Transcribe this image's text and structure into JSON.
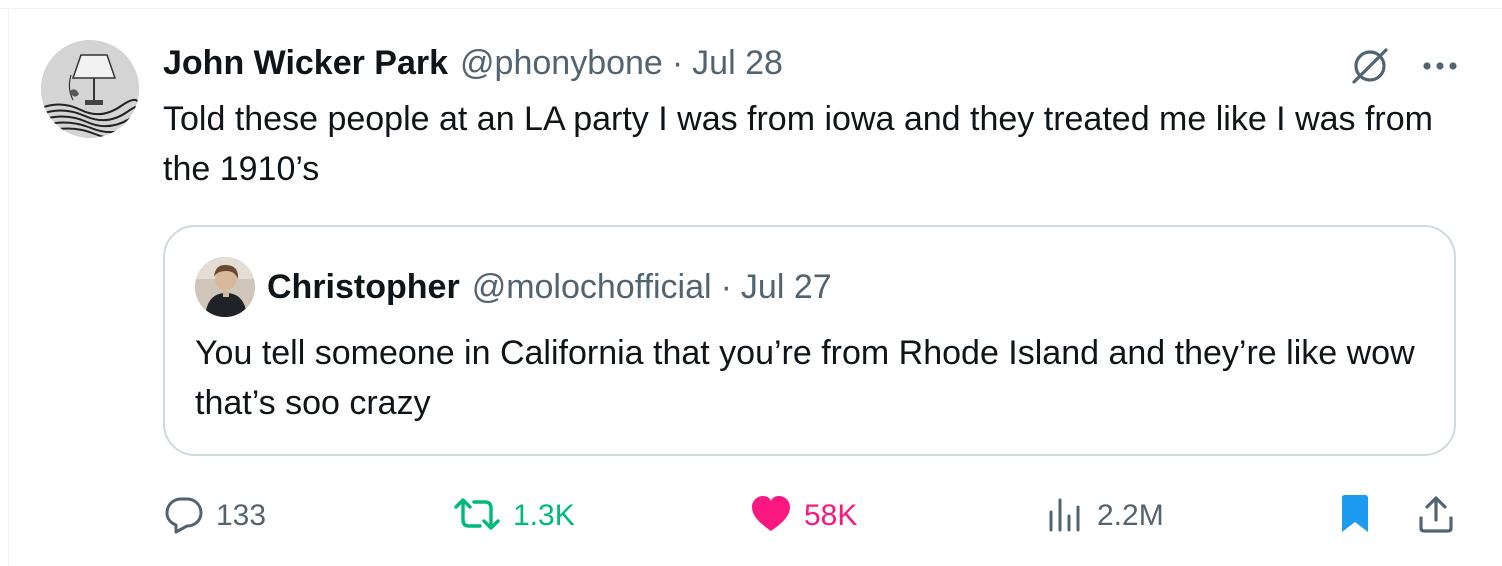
{
  "post": {
    "author_name": "John Wicker Park",
    "author_handle": "@phonybone",
    "separator": "·",
    "date": "Jul 28",
    "text": "Told these people at an LA party I was from iowa and they treated me like I was from the 1910’s"
  },
  "quote": {
    "author_name": "Christopher",
    "author_handle": "@molochofficial",
    "separator": "·",
    "date": "Jul 27",
    "text": "You tell someone in California that you’re from Rhode Island and they’re like wow that’s soo crazy"
  },
  "actions": {
    "replies": "133",
    "reposts": "1.3K",
    "likes": "58K",
    "views": "2.2M"
  },
  "icons": {
    "top_right": [
      "grok-icon",
      "more-icon"
    ],
    "bar": [
      "reply-icon",
      "repost-icon",
      "like-icon",
      "views-icon",
      "bookmark-icon",
      "share-icon"
    ]
  },
  "colors": {
    "text_primary": "#0f1419",
    "text_secondary": "#536471",
    "repost_green": "#00ba7c",
    "like_pink": "#f91880",
    "bookmark_blue": "#1d9bf0",
    "card_border": "#cfd9de"
  }
}
